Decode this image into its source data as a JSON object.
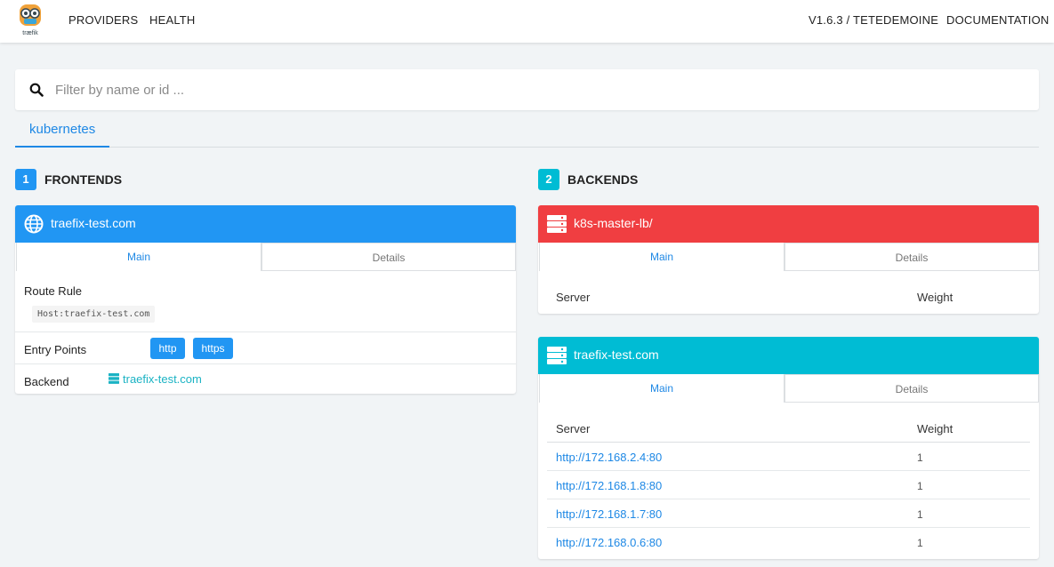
{
  "navbar": {
    "logo_text": "træfik",
    "providers": "PROVIDERS",
    "health": "HEALTH",
    "version": "V1.6.3 / TETEDEMOINE",
    "documentation": "DOCUMENTATION"
  },
  "search": {
    "placeholder": "Filter by name or id ...",
    "value": ""
  },
  "provider_tabs": [
    "kubernetes"
  ],
  "colors": {
    "accent": "#2196f3",
    "frontend_header": "#2196f3",
    "backend_error_header": "#f03e41",
    "backend_ok_header": "#00bcd4",
    "link_teal": "#1bb3c4"
  },
  "frontends": {
    "count": "1",
    "title": "FRONTENDS",
    "items": [
      {
        "name": "traefix-test.com",
        "icon": "globe-icon",
        "tabs": {
          "main": "Main",
          "details": "Details"
        },
        "route_rule_label": "Route Rule",
        "route_rule": "Host:traefix-test.com",
        "entry_points_label": "Entry Points",
        "entry_points": [
          "http",
          "https"
        ],
        "backend_label": "Backend",
        "backend": "traefix-test.com"
      }
    ]
  },
  "backends": {
    "count": "2",
    "title": "BACKENDS",
    "items": [
      {
        "name": "k8s-master-lb/",
        "icon": "server-icon",
        "status": "error",
        "tabs": {
          "main": "Main",
          "details": "Details"
        },
        "server_col": "Server",
        "weight_col": "Weight",
        "servers": []
      },
      {
        "name": "traefix-test.com",
        "icon": "server-icon",
        "status": "ok",
        "tabs": {
          "main": "Main",
          "details": "Details"
        },
        "server_col": "Server",
        "weight_col": "Weight",
        "servers": [
          {
            "url": "http://172.168.2.4:80",
            "weight": "1"
          },
          {
            "url": "http://172.168.1.8:80",
            "weight": "1"
          },
          {
            "url": "http://172.168.1.7:80",
            "weight": "1"
          },
          {
            "url": "http://172.168.0.6:80",
            "weight": "1"
          }
        ]
      }
    ]
  }
}
